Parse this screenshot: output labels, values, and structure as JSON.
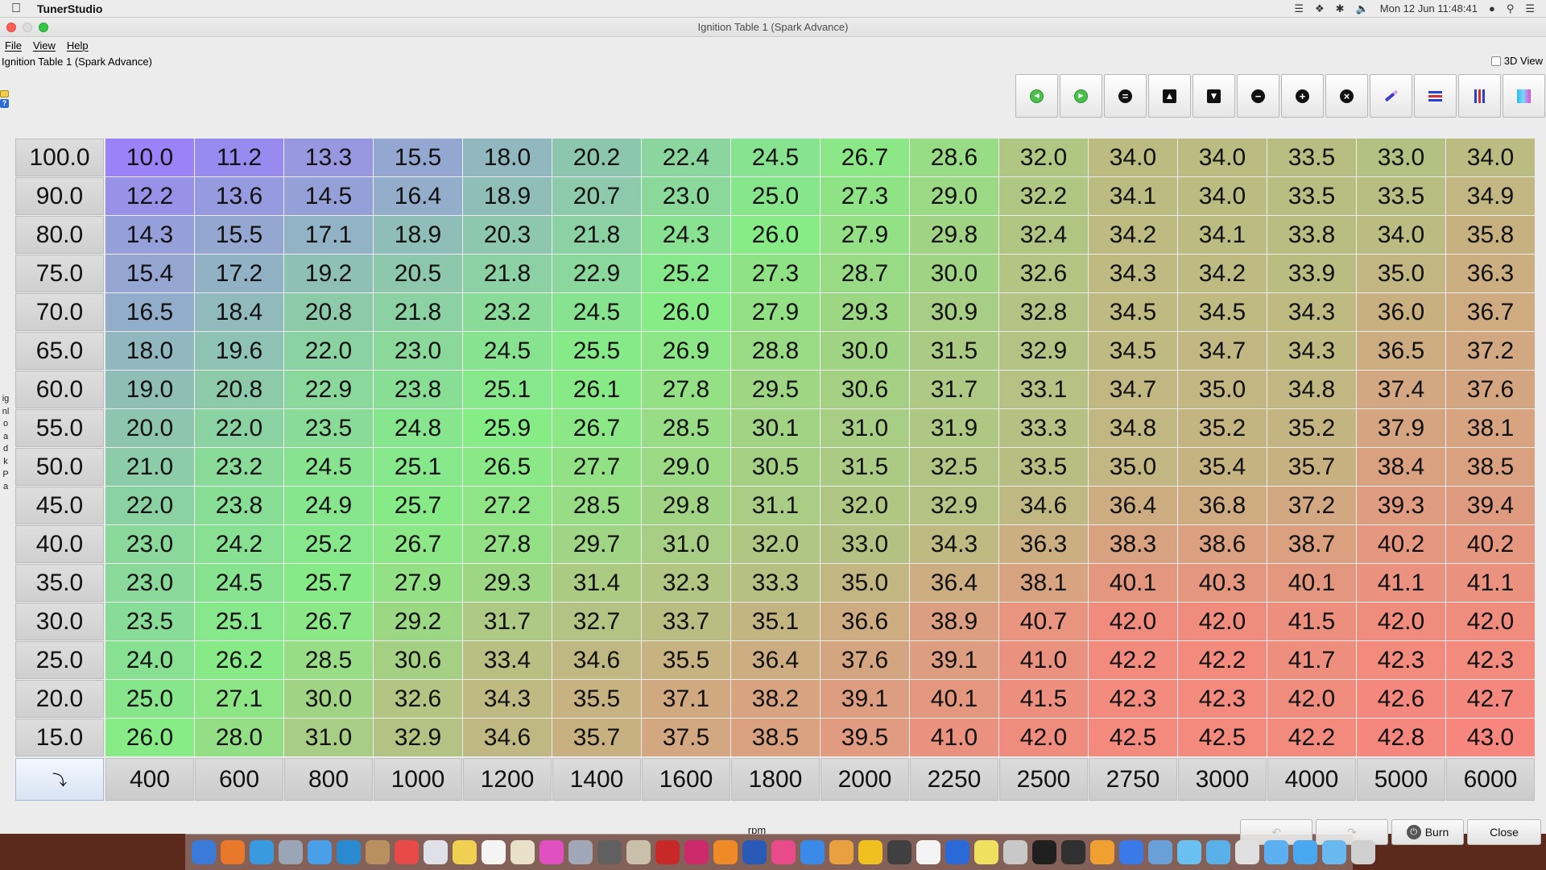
{
  "menubar": {
    "app_name": "TunerStudio",
    "clock": "Mon 12 Jun  11:48:41"
  },
  "window": {
    "title": "Ignition Table 1 (Spark Advance)",
    "menus": [
      "File",
      "View",
      "Help"
    ],
    "panel_title": "Ignition Table 1 (Spark Advance)",
    "view3d_label": "3D View"
  },
  "table": {
    "y_axis_label": "ignload kPa",
    "x_axis_label": "rpm",
    "y_values": [
      "100.0",
      "90.0",
      "80.0",
      "75.0",
      "70.0",
      "65.0",
      "60.0",
      "55.0",
      "50.0",
      "45.0",
      "40.0",
      "35.0",
      "30.0",
      "25.0",
      "20.0",
      "15.0"
    ],
    "x_values": [
      "400",
      "600",
      "800",
      "1000",
      "1200",
      "1400",
      "1600",
      "1800",
      "2000",
      "2250",
      "2500",
      "2750",
      "3000",
      "4000",
      "5000",
      "6000"
    ],
    "cells": [
      [
        "10.0",
        "11.2",
        "13.3",
        "15.5",
        "18.0",
        "20.2",
        "22.4",
        "24.5",
        "26.7",
        "28.6",
        "32.0",
        "34.0",
        "34.0",
        "33.5",
        "33.0",
        "34.0"
      ],
      [
        "12.2",
        "13.6",
        "14.5",
        "16.4",
        "18.9",
        "20.7",
        "23.0",
        "25.0",
        "27.3",
        "29.0",
        "32.2",
        "34.1",
        "34.0",
        "33.5",
        "33.5",
        "34.9"
      ],
      [
        "14.3",
        "15.5",
        "17.1",
        "18.9",
        "20.3",
        "21.8",
        "24.3",
        "26.0",
        "27.9",
        "29.8",
        "32.4",
        "34.2",
        "34.1",
        "33.8",
        "34.0",
        "35.8"
      ],
      [
        "15.4",
        "17.2",
        "19.2",
        "20.5",
        "21.8",
        "22.9",
        "25.2",
        "27.3",
        "28.7",
        "30.0",
        "32.6",
        "34.3",
        "34.2",
        "33.9",
        "35.0",
        "36.3"
      ],
      [
        "16.5",
        "18.4",
        "20.8",
        "21.8",
        "23.2",
        "24.5",
        "26.0",
        "27.9",
        "29.3",
        "30.9",
        "32.8",
        "34.5",
        "34.5",
        "34.3",
        "36.0",
        "36.7"
      ],
      [
        "18.0",
        "19.6",
        "22.0",
        "23.0",
        "24.5",
        "25.5",
        "26.9",
        "28.8",
        "30.0",
        "31.5",
        "32.9",
        "34.5",
        "34.7",
        "34.3",
        "36.5",
        "37.2"
      ],
      [
        "19.0",
        "20.8",
        "22.9",
        "23.8",
        "25.1",
        "26.1",
        "27.8",
        "29.5",
        "30.6",
        "31.7",
        "33.1",
        "34.7",
        "35.0",
        "34.8",
        "37.4",
        "37.6"
      ],
      [
        "20.0",
        "22.0",
        "23.5",
        "24.8",
        "25.9",
        "26.7",
        "28.5",
        "30.1",
        "31.0",
        "31.9",
        "33.3",
        "34.8",
        "35.2",
        "35.2",
        "37.9",
        "38.1"
      ],
      [
        "21.0",
        "23.2",
        "24.5",
        "25.1",
        "26.5",
        "27.7",
        "29.0",
        "30.5",
        "31.5",
        "32.5",
        "33.5",
        "35.0",
        "35.4",
        "35.7",
        "38.4",
        "38.5"
      ],
      [
        "22.0",
        "23.8",
        "24.9",
        "25.7",
        "27.2",
        "28.5",
        "29.8",
        "31.1",
        "32.0",
        "32.9",
        "34.6",
        "36.4",
        "36.8",
        "37.2",
        "39.3",
        "39.4"
      ],
      [
        "23.0",
        "24.2",
        "25.2",
        "26.7",
        "27.8",
        "29.7",
        "31.0",
        "32.0",
        "33.0",
        "34.3",
        "36.3",
        "38.3",
        "38.6",
        "38.7",
        "40.2",
        "40.2"
      ],
      [
        "23.0",
        "24.5",
        "25.7",
        "27.9",
        "29.3",
        "31.4",
        "32.3",
        "33.3",
        "35.0",
        "36.4",
        "38.1",
        "40.1",
        "40.3",
        "40.1",
        "41.1",
        "41.1"
      ],
      [
        "23.5",
        "25.1",
        "26.7",
        "29.2",
        "31.7",
        "32.7",
        "33.7",
        "35.1",
        "36.6",
        "38.9",
        "40.7",
        "42.0",
        "42.0",
        "41.5",
        "42.0",
        "42.0"
      ],
      [
        "24.0",
        "26.2",
        "28.5",
        "30.6",
        "33.4",
        "34.6",
        "35.5",
        "36.4",
        "37.6",
        "39.1",
        "41.0",
        "42.2",
        "42.2",
        "41.7",
        "42.3",
        "42.3"
      ],
      [
        "25.0",
        "27.1",
        "30.0",
        "32.6",
        "34.3",
        "35.5",
        "37.1",
        "38.2",
        "39.1",
        "40.1",
        "41.5",
        "42.3",
        "42.3",
        "42.0",
        "42.6",
        "42.7"
      ],
      [
        "26.0",
        "28.0",
        "31.0",
        "32.9",
        "34.6",
        "35.7",
        "37.5",
        "38.5",
        "39.5",
        "41.0",
        "42.0",
        "42.5",
        "42.5",
        "42.2",
        "42.8",
        "43.0"
      ]
    ]
  },
  "toolbar": {
    "buttons": [
      {
        "name": "go-back-icon",
        "glyph": "◀",
        "style": "green"
      },
      {
        "name": "go-forward-icon",
        "glyph": "▶",
        "style": "green"
      },
      {
        "name": "set-equal-icon",
        "glyph": "=",
        "style": "black"
      },
      {
        "name": "increment-icon",
        "glyph": "▲",
        "style": "square"
      },
      {
        "name": "decrement-icon",
        "glyph": "▼",
        "style": "square"
      },
      {
        "name": "subtract-icon",
        "glyph": "−",
        "style": "black"
      },
      {
        "name": "add-icon",
        "glyph": "+",
        "style": "black"
      },
      {
        "name": "multiply-icon",
        "glyph": "×",
        "style": "black"
      },
      {
        "name": "pencil-icon",
        "glyph": "",
        "style": "pencil"
      },
      {
        "name": "interpolate-rows-icon",
        "glyph": "",
        "style": "bars"
      },
      {
        "name": "interpolate-columns-icon",
        "glyph": "",
        "style": "cols"
      },
      {
        "name": "color-scale-icon",
        "glyph": "",
        "style": "grad"
      }
    ]
  },
  "bottom": {
    "burn_label": "Burn",
    "close_label": "Close"
  },
  "colors": {
    "low": "#9b82f8",
    "mid": "#86ec86",
    "high": "#f7867e"
  }
}
